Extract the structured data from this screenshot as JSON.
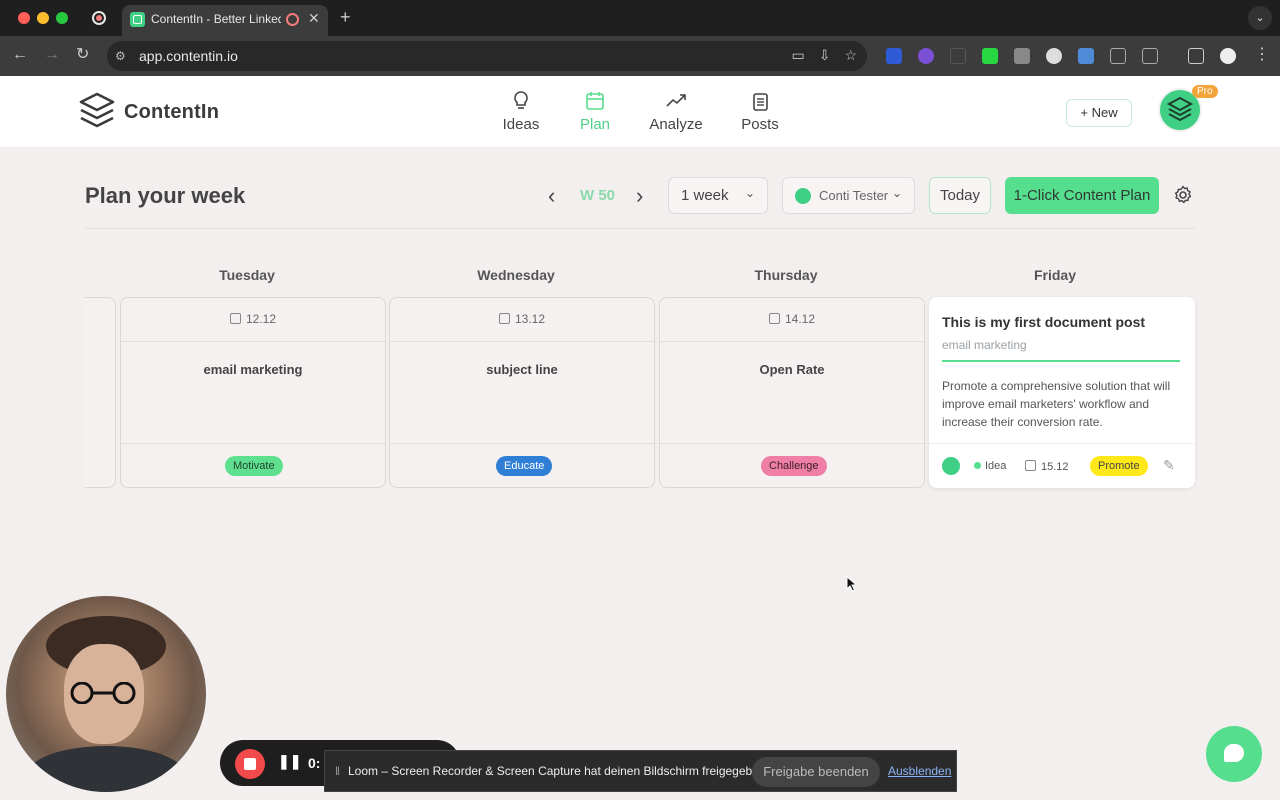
{
  "browser": {
    "tab_title": "ContentIn - Better LinkedIn",
    "new_tab_symbol": "+",
    "url": "app.contentin.io"
  },
  "app": {
    "brand": "ContentIn",
    "nav": [
      {
        "label": "Ideas",
        "icon": "lightbulb-icon"
      },
      {
        "label": "Plan",
        "icon": "calendar-icon",
        "active": true
      },
      {
        "label": "Analyze",
        "icon": "trending-up-icon"
      },
      {
        "label": "Posts",
        "icon": "documents-icon"
      }
    ],
    "new_button": "New",
    "pro_badge": "Pro",
    "accent_color": "#55de8e"
  },
  "plan": {
    "title": "Plan your week",
    "week_label": "W 50",
    "range_select": "1 week",
    "profile_select": "Conti Tester",
    "today_button": "Today",
    "content_plan_button": "1-Click Content Plan",
    "days": [
      {
        "name": "Tuesday",
        "date": "12.12",
        "topic": "email marketing",
        "tag": "Motivate",
        "tag_color": "#5fe08f"
      },
      {
        "name": "Wednesday",
        "date": "13.12",
        "topic": "subject line",
        "tag": "Educate",
        "tag_color": "#2f7fd6"
      },
      {
        "name": "Thursday",
        "date": "14.12",
        "topic": "Open Rate",
        "tag": "Challenge",
        "tag_color": "#ef7fa6"
      },
      {
        "name": "Friday"
      }
    ],
    "post": {
      "title": "This is my first document post",
      "topic": "email marketing",
      "body": "Promote a comprehensive solution that will improve email marketers' workflow and increase their conversion rate.",
      "status": "Idea",
      "date": "15.12",
      "tag": "Promote",
      "tag_color": "#ffe81a"
    }
  },
  "loom": {
    "timer": "0:",
    "share_message": "Loom – Screen Recorder & Screen Capture hat deinen Bildschirm freigegeben.",
    "stop_sharing": "Freigabe beenden",
    "hide": "Ausblenden"
  }
}
